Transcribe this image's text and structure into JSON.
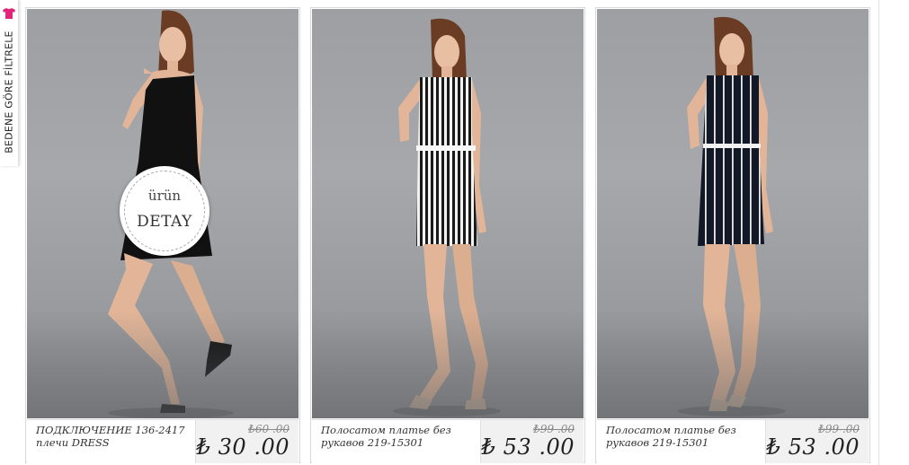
{
  "filter": {
    "label": "BEDENE GÖRE FİLTRELE",
    "icon": "tshirt-icon",
    "accent": "#e0257a"
  },
  "badge": {
    "line1": "ürün",
    "line2": "DETAY"
  },
  "products": [
    {
      "name": "ПОДКЛЮЧЕНИЕ 136-2417 плечи DRESS",
      "old_price": "₺60 .00",
      "new_price": "₺ 30 .00",
      "dress": "black"
    },
    {
      "name": "Полосатом платье без рукавов 219-15301",
      "old_price": "₺99 .00",
      "new_price": "₺ 53 .00",
      "dress": "white-stripe"
    },
    {
      "name": "Полосатом платье без рукавов 219-15301",
      "old_price": "₺99 .00",
      "new_price": "₺ 53 .00",
      "dress": "navy-stripe"
    }
  ]
}
